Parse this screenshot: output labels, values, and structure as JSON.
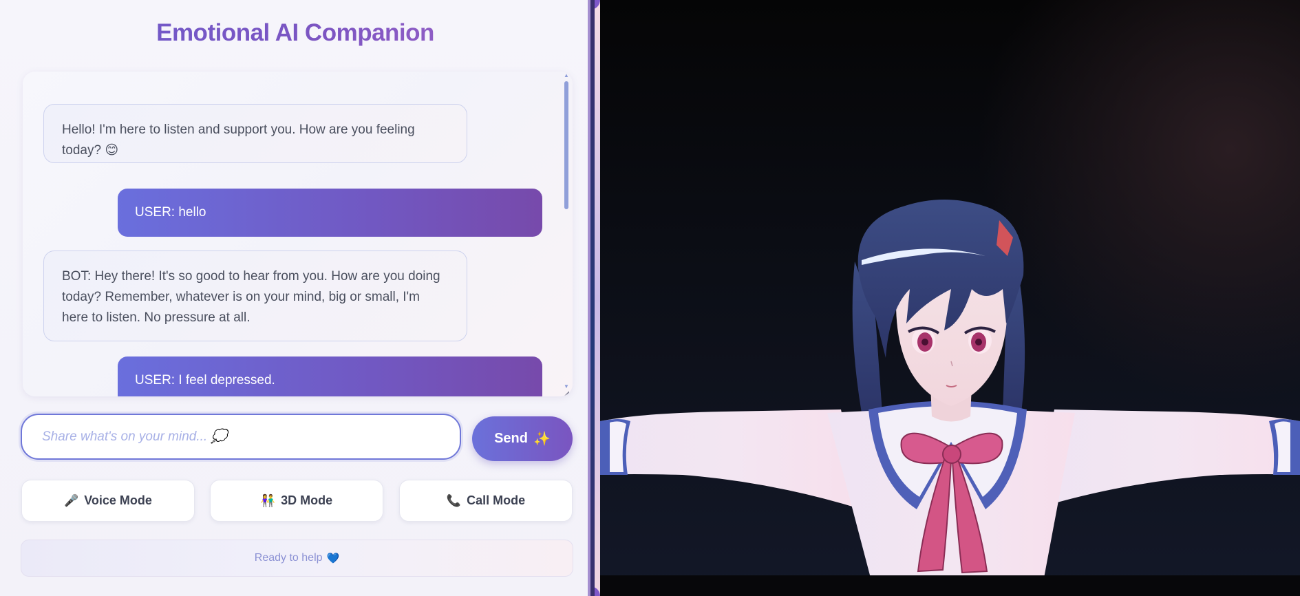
{
  "app": {
    "title": "Emotional AI Companion"
  },
  "chat": {
    "messages": [
      {
        "role": "bot",
        "text": "Hello! I'm here to listen and support you. How are you feeling today? 😊"
      },
      {
        "role": "user",
        "text": "USER: hello"
      },
      {
        "role": "bot",
        "text": "BOT: Hey there! It's so good to hear from you. How are you doing today? Remember, whatever is on your mind, big or small, I'm here to listen. No pressure at all."
      },
      {
        "role": "user",
        "text": "USER: I feel depressed."
      }
    ]
  },
  "input": {
    "placeholder": "Share what's on your mind... 💭",
    "value": ""
  },
  "send_button": {
    "label": "Send",
    "icon": "sparkles-icon",
    "emoji": "✨"
  },
  "modes": [
    {
      "label": "Voice Mode",
      "icon": "microphone-icon",
      "emoji": "🎤"
    },
    {
      "label": "3D Mode",
      "icon": "people-icon",
      "emoji": "👫"
    },
    {
      "label": "Call Mode",
      "icon": "phone-icon",
      "emoji": "📞"
    }
  ],
  "status": {
    "text": "Ready to help",
    "emoji": "💙"
  },
  "colors": {
    "accent": "#6b71da",
    "accent_purple": "#7a55c0",
    "title_gradient_start": "#6b5ccc",
    "title_gradient_end": "#a766c9",
    "viewport_bg": "#0b0d14"
  }
}
